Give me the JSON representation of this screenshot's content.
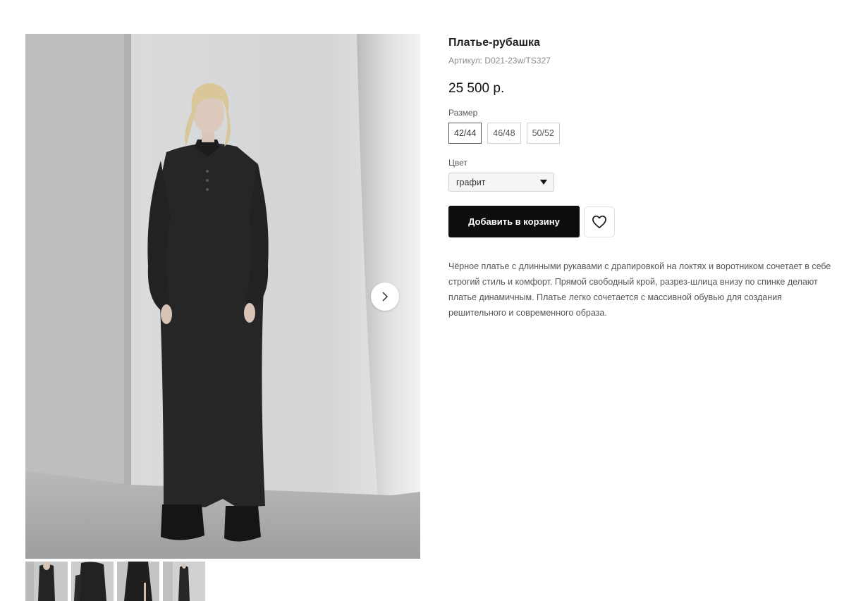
{
  "product": {
    "title": "Платье-рубашка",
    "sku_label": "Артикул:",
    "sku_value": "D021-23w/TS327",
    "price": "25 500 р.",
    "size_label": "Размер",
    "sizes": [
      "42/44",
      "46/48",
      "50/52"
    ],
    "selected_size": "42/44",
    "color_label": "Цвет",
    "color_value": "графит",
    "add_to_cart_label": "Добавить в корзину",
    "description": "Чёрное платье с длинными рукавами с драпировкой на локтях и воротником сочетает в себе строгий стиль и комфорт. Прямой свободный крой, разрез-шлица внизу по спинке делают платье динамичным. Платье легко сочетается с массивной обувью для создания решительного и современного образа."
  },
  "gallery": {
    "thumbnail_count": 4,
    "icons": {
      "next": "chevron-right-icon",
      "wishlist": "heart-outline-icon",
      "dropdown": "caret-down-icon"
    }
  },
  "colors": {
    "button_bg": "#0d0d0d",
    "button_text": "#ffffff",
    "muted_text": "#8a8a8a"
  }
}
